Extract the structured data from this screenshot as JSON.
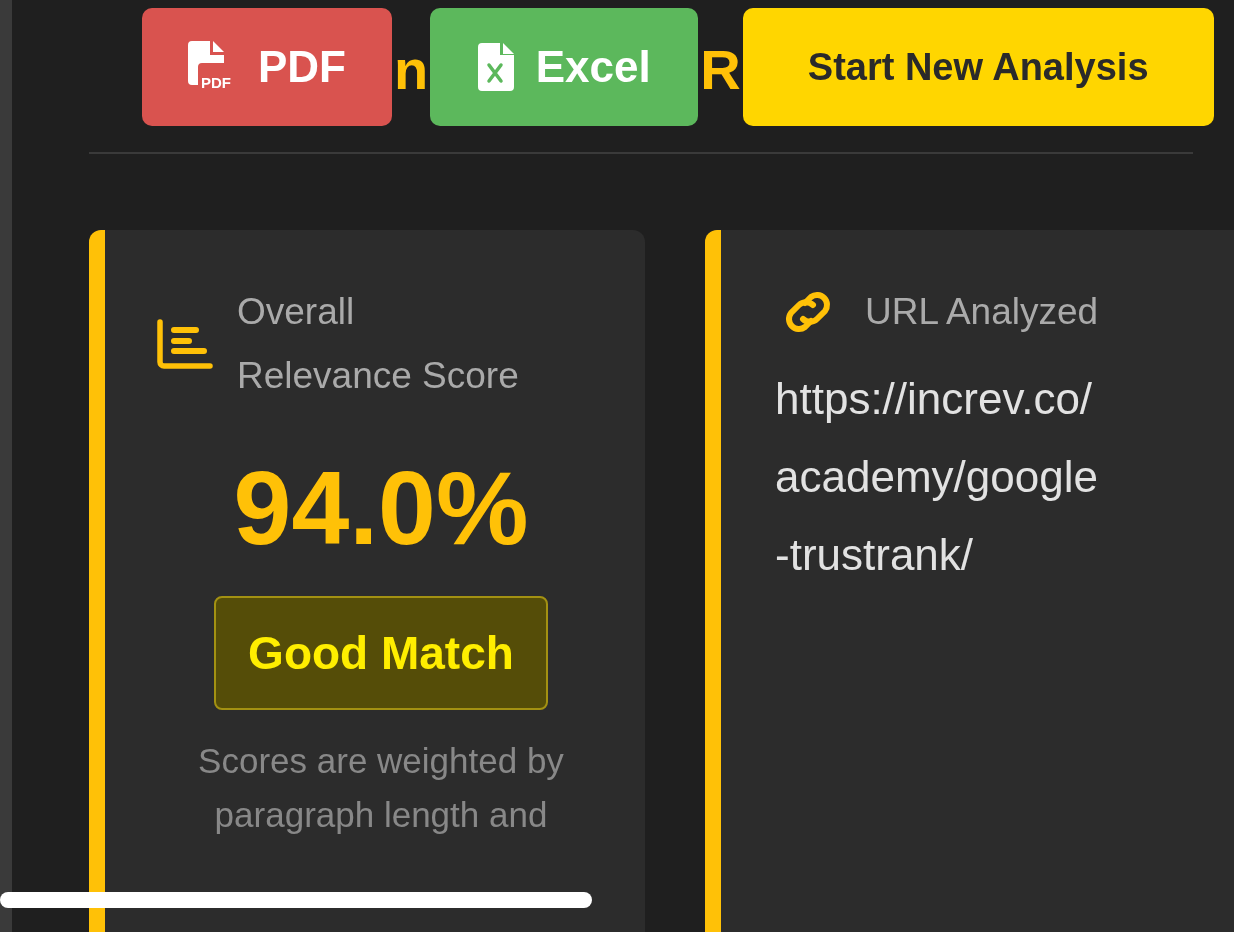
{
  "header": {
    "title_fragments": [
      "n",
      "R"
    ],
    "buttons": [
      {
        "kind": "pdf",
        "label": "PDF",
        "icon_text": "PDF"
      },
      {
        "kind": "excel",
        "label": "Excel"
      },
      {
        "kind": "primary",
        "label": "Start New Analysis"
      }
    ]
  },
  "cards": [
    {
      "kind": "score",
      "title": "Overall Relevance Score",
      "score": "94.0%",
      "badge": "Good Match",
      "note": "Scores are weighted by paragraph length and"
    },
    {
      "kind": "url",
      "title": "URL Analyzed",
      "url": "https://increv.co/academy/google-trustrank/"
    }
  ]
}
